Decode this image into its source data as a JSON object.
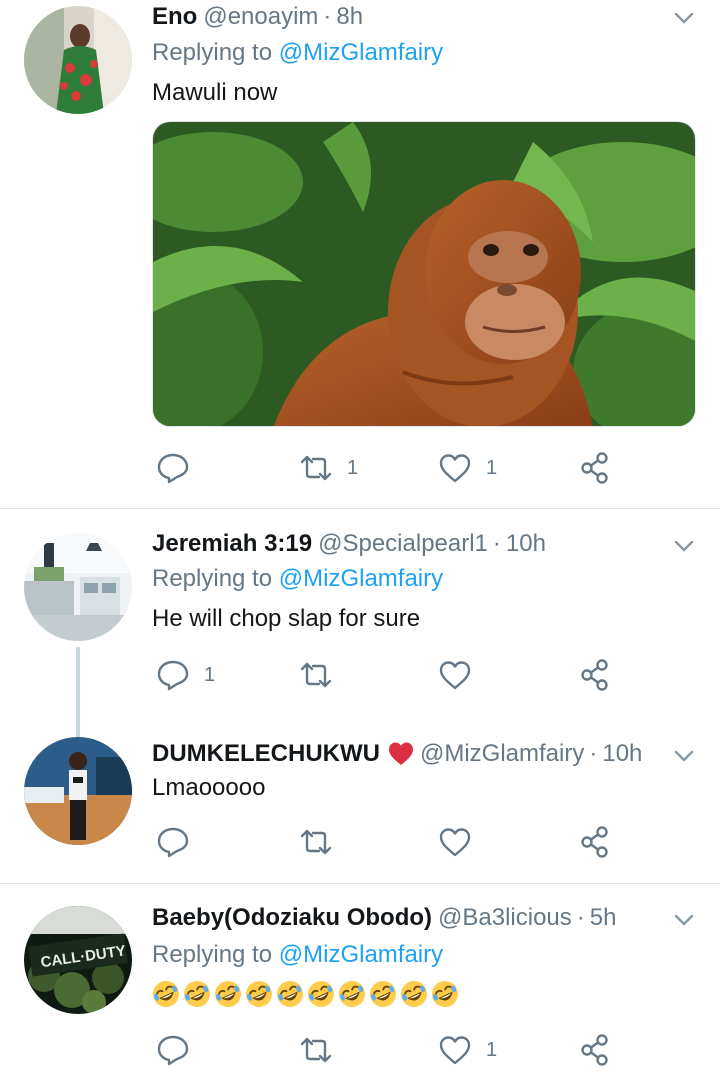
{
  "tweets": [
    {
      "name": "Eno",
      "handle": "@enoayim",
      "time": "8h",
      "replying_prefix": "Replying to",
      "replying_to": "@MizGlamfairy",
      "text": "Mawuli now",
      "actions": {
        "reply_count": "",
        "retweet_count": "1",
        "like_count": "1"
      }
    },
    {
      "name": "Jeremiah 3:19",
      "handle": "@Specialpearl1",
      "time": "10h",
      "replying_prefix": "Replying to",
      "replying_to": "@MizGlamfairy",
      "text": "He will chop slap for sure",
      "actions": {
        "reply_count": "1",
        "retweet_count": "",
        "like_count": ""
      }
    },
    {
      "name": "DUMKELECHUKWU",
      "handle": "@MizGlamfairy",
      "time": "10h",
      "text": "Lmaooooo",
      "actions": {
        "reply_count": "",
        "retweet_count": "",
        "like_count": ""
      }
    },
    {
      "name": "Baeby(Odoziaku Obodo)",
      "handle": "@Ba3licious",
      "time": "5h",
      "replying_prefix": "Replying to",
      "replying_to": "@MizGlamfairy",
      "emoji_count": 10,
      "emoji": "rolling-on-floor-laughing",
      "actions": {
        "reply_count": "",
        "retweet_count": "",
        "like_count": "1"
      }
    }
  ],
  "separator": "·",
  "colors": {
    "text_primary": "#14171a",
    "text_secondary": "#657786",
    "link": "#1da1f2",
    "divider": "#e1e8ed",
    "thread_line": "#ccd6dd",
    "heart_emoji": "#e0245e"
  },
  "icons": [
    "reply-icon",
    "retweet-icon",
    "like-icon",
    "share-icon",
    "chevron-down-icon"
  ]
}
